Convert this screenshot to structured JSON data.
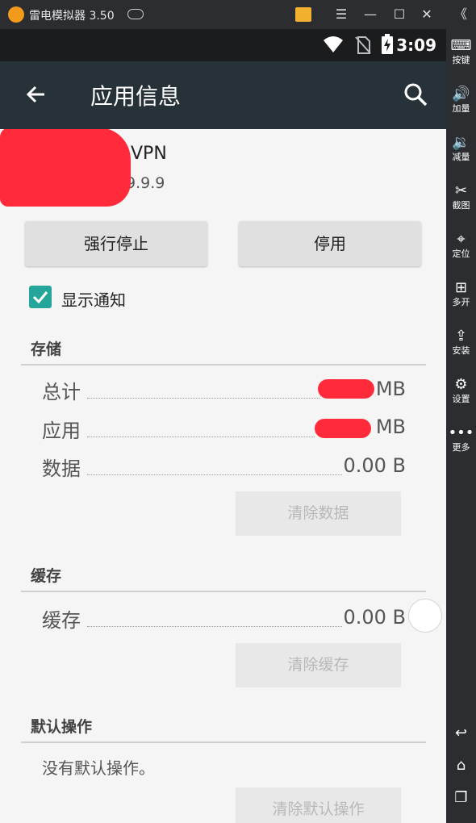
{
  "emulator": {
    "title": "雷电模拟器 3.50",
    "controls": {
      "gift": "gift-icon",
      "menu": "☰",
      "minimize": "—",
      "maximize": "☐",
      "close": "✕",
      "collapse": "《"
    }
  },
  "status_bar": {
    "time": "3:09"
  },
  "app_bar": {
    "title": "应用信息"
  },
  "app": {
    "name_suffix": "VPN",
    "version": "版本 9.9.9"
  },
  "actions": {
    "force_stop": "强行停止",
    "disable": "停用"
  },
  "notifications": {
    "label": "显示通知",
    "checked": true
  },
  "storage": {
    "header": "存储",
    "rows": [
      {
        "label": "总计",
        "value": "MB"
      },
      {
        "label": "应用",
        "value": "MB"
      },
      {
        "label": "数据",
        "value": "0.00 B"
      }
    ],
    "clear_data": "清除数据"
  },
  "cache": {
    "header": "缓存",
    "row": {
      "label": "缓存",
      "value": "0.00 B"
    },
    "clear_cache": "清除缓存"
  },
  "defaults": {
    "header": "默认操作",
    "text": "没有默认操作。",
    "clear_defaults": "清除默认操作"
  },
  "sidebar": {
    "items": [
      {
        "label": "按键",
        "icon": "keyboard-icon"
      },
      {
        "label": "加量",
        "icon": "volume-up-icon"
      },
      {
        "label": "减量",
        "icon": "volume-down-icon"
      },
      {
        "label": "截图",
        "icon": "scissors-icon"
      },
      {
        "label": "定位",
        "icon": "location-pin-icon"
      },
      {
        "label": "多开",
        "icon": "multi-instance-icon"
      },
      {
        "label": "安装",
        "icon": "apk-install-icon"
      },
      {
        "label": "设置",
        "icon": "gear-icon"
      },
      {
        "label": "更多",
        "icon": "more-dots-icon"
      }
    ],
    "nav": [
      "back-icon",
      "home-icon",
      "recents-icon"
    ]
  },
  "colors": {
    "accent": "#26a69a",
    "app_bar": "#263238",
    "redaction": "#ff2b3a"
  }
}
